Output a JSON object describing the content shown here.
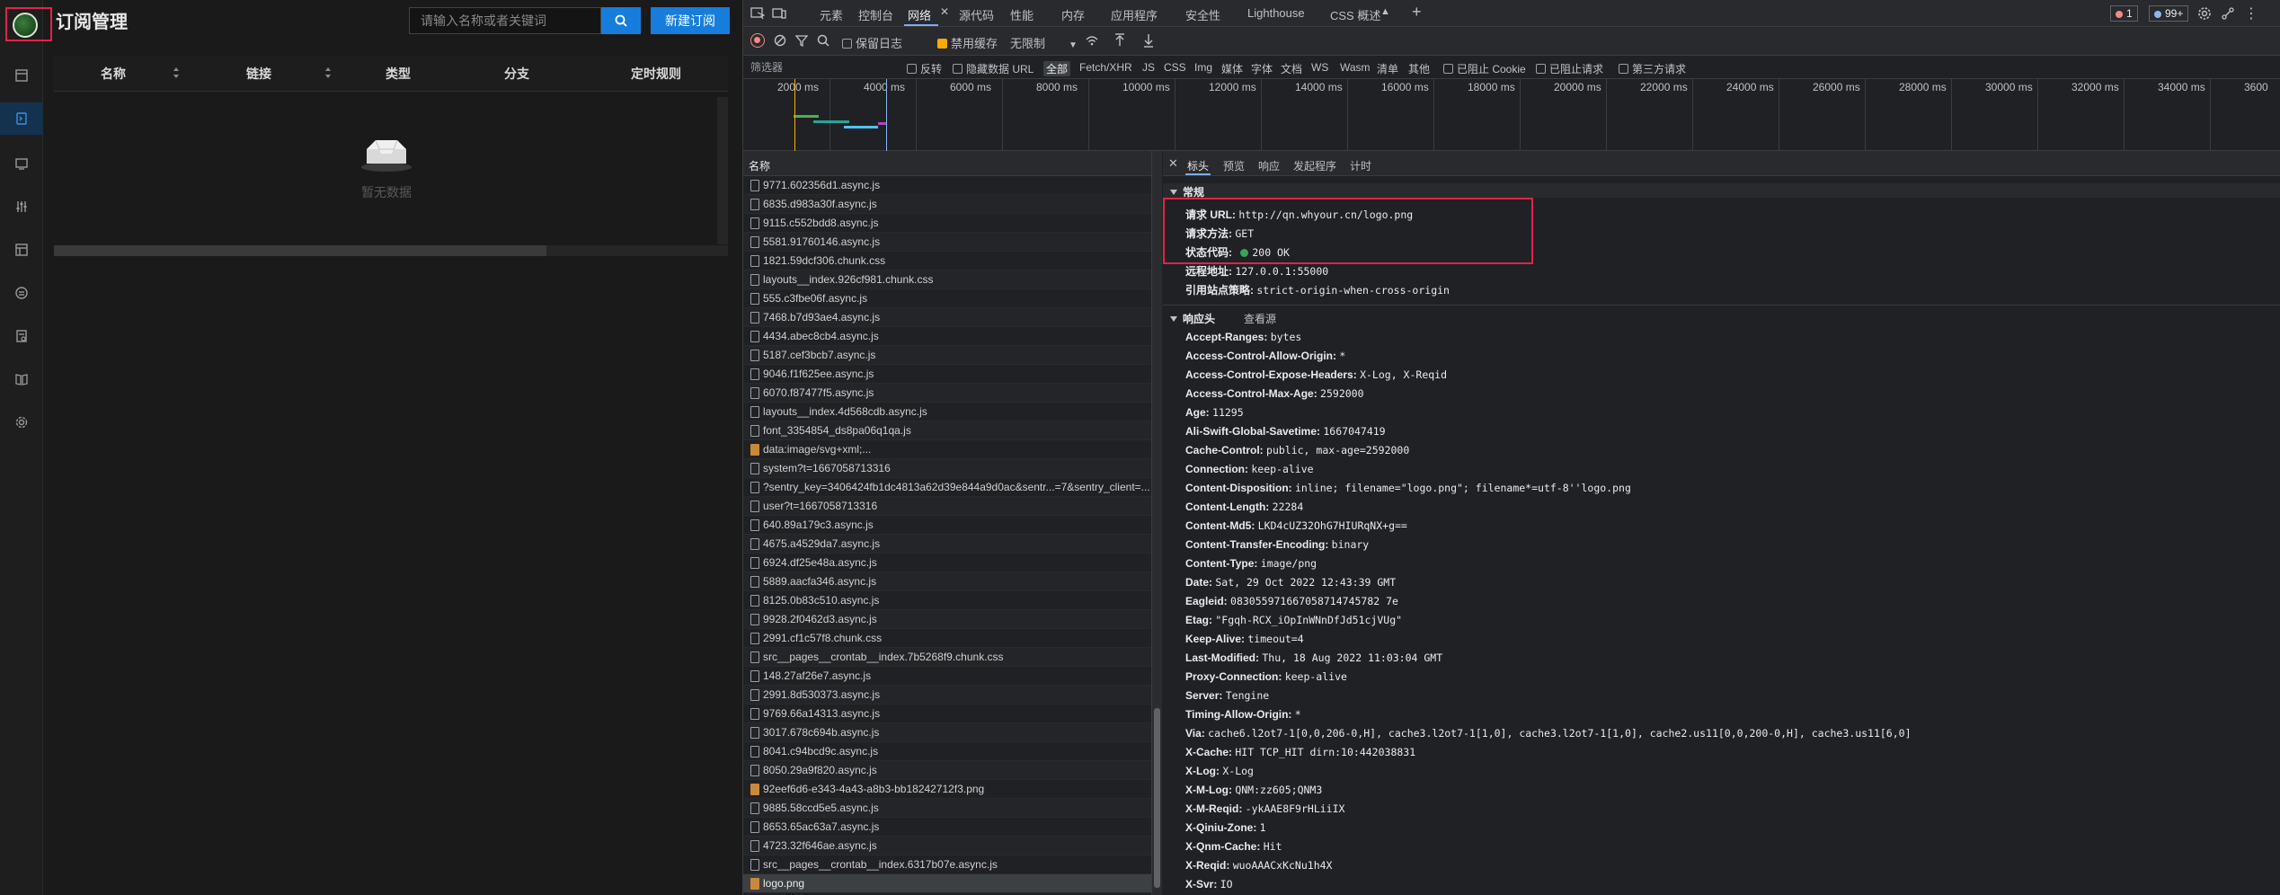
{
  "app": {
    "title": "订阅管理",
    "search_placeholder": "请输入名称或者关键词",
    "new_button": "新建订阅",
    "columns": [
      "名称",
      "链接",
      "类型",
      "分支",
      "定时规则"
    ],
    "empty_text": "暂无数据"
  },
  "devtools": {
    "tabs": [
      "元素",
      "控制台",
      "网络",
      "源代码",
      "性能",
      "内存",
      "应用程序",
      "安全性",
      "Lighthouse",
      "CSS 概述"
    ],
    "active_tab": "网络",
    "error_count": "1",
    "issue_count": "99+",
    "toolbar": {
      "preserve_log": "保留日志",
      "disable_cache": "禁用缓存",
      "throttle": "无限制"
    },
    "filter": {
      "placeholder": "筛选器",
      "invert": "反转",
      "hide_data_urls": "隐藏数据 URL",
      "types": [
        "全部",
        "Fetch/XHR",
        "JS",
        "CSS",
        "Img",
        "媒体",
        "字体",
        "文档",
        "WS",
        "Wasm",
        "清单",
        "其他"
      ],
      "blocked_cookies": "已阻止 Cookie",
      "blocked_requests": "已阻止请求",
      "third_party": "第三方请求"
    },
    "timeline_labels": [
      "2000 ms",
      "4000 ms",
      "6000 ms",
      "8000 ms",
      "10000 ms",
      "12000 ms",
      "14000 ms",
      "16000 ms",
      "18000 ms",
      "20000 ms",
      "22000 ms",
      "24000 ms",
      "26000 ms",
      "28000 ms",
      "30000 ms",
      "32000 ms",
      "34000 ms",
      "3600"
    ],
    "list_header": "名称",
    "requests": [
      {
        "name": "9771.602356d1.async.js",
        "type": "js"
      },
      {
        "name": "6835.d983a30f.async.js",
        "type": "js"
      },
      {
        "name": "9115.c552bdd8.async.js",
        "type": "js"
      },
      {
        "name": "5581.91760146.async.js",
        "type": "js"
      },
      {
        "name": "1821.59dcf306.chunk.css",
        "type": "css"
      },
      {
        "name": "layouts__index.926cf981.chunk.css",
        "type": "css"
      },
      {
        "name": "555.c3fbe06f.async.js",
        "type": "js"
      },
      {
        "name": "7468.b7d93ae4.async.js",
        "type": "js"
      },
      {
        "name": "4434.abec8cb4.async.js",
        "type": "js"
      },
      {
        "name": "5187.cef3bcb7.async.js",
        "type": "js"
      },
      {
        "name": "9046.f1f625ee.async.js",
        "type": "js"
      },
      {
        "name": "6070.f87477f5.async.js",
        "type": "js"
      },
      {
        "name": "layouts__index.4d568cdb.async.js",
        "type": "js"
      },
      {
        "name": "font_3354854_ds8pa06q1qa.js",
        "type": "js"
      },
      {
        "name": "data:image/svg+xml;...",
        "type": "img"
      },
      {
        "name": "system?t=1667058713316",
        "type": "js"
      },
      {
        "name": "?sentry_key=3406424fb1dc4813a62d39e844a9d0ac&sentr...=7&sentry_client=...",
        "type": "js"
      },
      {
        "name": "user?t=1667058713316",
        "type": "js"
      },
      {
        "name": "640.89a179c3.async.js",
        "type": "js"
      },
      {
        "name": "4675.a4529da7.async.js",
        "type": "js"
      },
      {
        "name": "6924.df25e48a.async.js",
        "type": "js"
      },
      {
        "name": "5889.aacfa346.async.js",
        "type": "js"
      },
      {
        "name": "8125.0b83c510.async.js",
        "type": "js"
      },
      {
        "name": "9928.2f0462d3.async.js",
        "type": "js"
      },
      {
        "name": "2991.cf1c57f8.chunk.css",
        "type": "css"
      },
      {
        "name": "src__pages__crontab__index.7b5268f9.chunk.css",
        "type": "css"
      },
      {
        "name": "148.27af26e7.async.js",
        "type": "js"
      },
      {
        "name": "2991.8d530373.async.js",
        "type": "js"
      },
      {
        "name": "9769.66a14313.async.js",
        "type": "js"
      },
      {
        "name": "3017.678c694b.async.js",
        "type": "js"
      },
      {
        "name": "8041.c94bcd9c.async.js",
        "type": "js"
      },
      {
        "name": "8050.29a9f820.async.js",
        "type": "js"
      },
      {
        "name": "92eef6d6-e343-4a43-a8b3-bb18242712f3.png",
        "type": "img"
      },
      {
        "name": "9885.58ccd5e5.async.js",
        "type": "js"
      },
      {
        "name": "8653.65ac63a7.async.js",
        "type": "js"
      },
      {
        "name": "4723.32f646ae.async.js",
        "type": "js"
      },
      {
        "name": "src__pages__crontab__index.6317b07e.async.js",
        "type": "js"
      },
      {
        "name": "logo.png",
        "type": "img",
        "selected": true
      }
    ],
    "detail": {
      "tabs": [
        "标头",
        "预览",
        "响应",
        "发起程序",
        "计时"
      ],
      "active_tab": "标头",
      "general_title": "常规",
      "general": [
        {
          "k": "请求 URL:",
          "v": "http://qn.whyour.cn/logo.png"
        },
        {
          "k": "请求方法:",
          "v": "GET"
        },
        {
          "k": "状态代码:",
          "v": "200 OK"
        },
        {
          "k": "远程地址:",
          "v": "127.0.0.1:55000"
        },
        {
          "k": "引用站点策略:",
          "v": "strict-origin-when-cross-origin"
        }
      ],
      "response_title": "响应头",
      "view_source": "查看源",
      "response_headers": [
        {
          "k": "Accept-Ranges:",
          "v": "bytes"
        },
        {
          "k": "Access-Control-Allow-Origin:",
          "v": "*"
        },
        {
          "k": "Access-Control-Expose-Headers:",
          "v": "X-Log, X-Reqid"
        },
        {
          "k": "Access-Control-Max-Age:",
          "v": "2592000"
        },
        {
          "k": "Age:",
          "v": "11295"
        },
        {
          "k": "Ali-Swift-Global-Savetime:",
          "v": "1667047419"
        },
        {
          "k": "Cache-Control:",
          "v": "public, max-age=2592000"
        },
        {
          "k": "Connection:",
          "v": "keep-alive"
        },
        {
          "k": "Content-Disposition:",
          "v": "inline; filename=\"logo.png\"; filename*=utf-8''logo.png"
        },
        {
          "k": "Content-Length:",
          "v": "22284"
        },
        {
          "k": "Content-Md5:",
          "v": "LKD4cUZ32OhG7HIURqNX+g=="
        },
        {
          "k": "Content-Transfer-Encoding:",
          "v": "binary"
        },
        {
          "k": "Content-Type:",
          "v": "image/png"
        },
        {
          "k": "Date:",
          "v": "Sat, 29 Oct 2022 12:43:39 GMT"
        },
        {
          "k": "Eagleid:",
          "v": "083055971667058714745782 7e"
        },
        {
          "k": "Etag:",
          "v": "\"Fgqh-RCX_iOpInWNnDfJd51cjVUg\""
        },
        {
          "k": "Keep-Alive:",
          "v": "timeout=4"
        },
        {
          "k": "Last-Modified:",
          "v": "Thu, 18 Aug 2022 11:03:04 GMT"
        },
        {
          "k": "Proxy-Connection:",
          "v": "keep-alive"
        },
        {
          "k": "Server:",
          "v": "Tengine"
        },
        {
          "k": "Timing-Allow-Origin:",
          "v": "*"
        },
        {
          "k": "Via:",
          "v": "cache6.l2ot7-1[0,0,206-0,H], cache3.l2ot7-1[1,0], cache3.l2ot7-1[1,0], cache2.us11[0,0,200-0,H], cache3.us11[6,0]"
        },
        {
          "k": "X-Cache:",
          "v": "HIT TCP_HIT dirn:10:442038831"
        },
        {
          "k": "X-Log:",
          "v": "X-Log"
        },
        {
          "k": "X-M-Log:",
          "v": "QNM:zz605;QNM3"
        },
        {
          "k": "X-M-Reqid:",
          "v": "-ykAAE8F9rHLiiIX"
        },
        {
          "k": "X-Qiniu-Zone:",
          "v": "1"
        },
        {
          "k": "X-Qnm-Cache:",
          "v": "Hit"
        },
        {
          "k": "X-Reqid:",
          "v": "wuoAAACxKcNu1h4X"
        },
        {
          "k": "X-Svr:",
          "v": "IO"
        }
      ]
    },
    "colors": {
      "accent": "#7cacf8",
      "highlight": "#e0244a",
      "primary_button": "#177ddc",
      "status_ok": "#34a853"
    }
  }
}
